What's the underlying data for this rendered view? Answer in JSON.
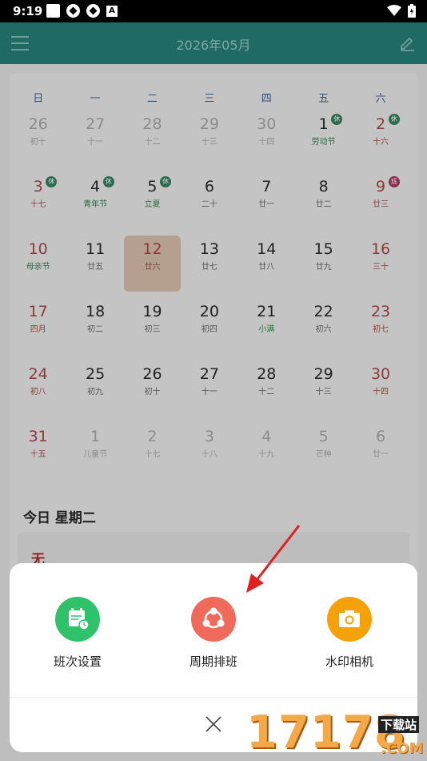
{
  "status_bar": {
    "time": "9:19",
    "a_label": "A"
  },
  "app_bar": {
    "title": "2026年05月"
  },
  "calendar": {
    "weekdays": [
      "日",
      "一",
      "二",
      "三",
      "四",
      "五",
      "六"
    ],
    "days": [
      {
        "d": "26",
        "l": "初十",
        "dim": true
      },
      {
        "d": "27",
        "l": "十一",
        "dim": true
      },
      {
        "d": "28",
        "l": "十二",
        "dim": true
      },
      {
        "d": "29",
        "l": "十三",
        "dim": true
      },
      {
        "d": "30",
        "l": "十四",
        "dim": true
      },
      {
        "d": "1",
        "l": "劳动节",
        "hol": true,
        "badge": "休"
      },
      {
        "d": "2",
        "l": "十六",
        "red": true,
        "badge": "休"
      },
      {
        "d": "3",
        "l": "十七",
        "red": true,
        "badge": "休"
      },
      {
        "d": "4",
        "l": "青年节",
        "hol": true,
        "badge": "休"
      },
      {
        "d": "5",
        "l": "立夏",
        "hol": true,
        "badge": "休"
      },
      {
        "d": "6",
        "l": "二十"
      },
      {
        "d": "7",
        "l": "廿一"
      },
      {
        "d": "8",
        "l": "廿二"
      },
      {
        "d": "9",
        "l": "廿三",
        "red": true,
        "badge": "班",
        "work": true
      },
      {
        "d": "10",
        "l": "母亲节",
        "red": true,
        "hol": true
      },
      {
        "d": "11",
        "l": "廿五"
      },
      {
        "d": "12",
        "l": "廿六",
        "today": true
      },
      {
        "d": "13",
        "l": "廿七"
      },
      {
        "d": "14",
        "l": "廿八"
      },
      {
        "d": "15",
        "l": "廿九"
      },
      {
        "d": "16",
        "l": "三十",
        "red": true
      },
      {
        "d": "17",
        "l": "四月",
        "red": true
      },
      {
        "d": "18",
        "l": "初二"
      },
      {
        "d": "19",
        "l": "初三"
      },
      {
        "d": "20",
        "l": "初四"
      },
      {
        "d": "21",
        "l": "小满",
        "hol": true
      },
      {
        "d": "22",
        "l": "初六"
      },
      {
        "d": "23",
        "l": "初七",
        "red": true
      },
      {
        "d": "24",
        "l": "初八",
        "red": true
      },
      {
        "d": "25",
        "l": "初九"
      },
      {
        "d": "26",
        "l": "初十"
      },
      {
        "d": "27",
        "l": "十一"
      },
      {
        "d": "28",
        "l": "十二"
      },
      {
        "d": "29",
        "l": "十三"
      },
      {
        "d": "30",
        "l": "十四",
        "red": true
      },
      {
        "d": "31",
        "l": "十五",
        "red": true
      },
      {
        "d": "1",
        "l": "儿童节",
        "dim": true
      },
      {
        "d": "2",
        "l": "十七",
        "dim": true
      },
      {
        "d": "3",
        "l": "十八",
        "dim": true
      },
      {
        "d": "4",
        "l": "十九",
        "dim": true
      },
      {
        "d": "5",
        "l": "芒种",
        "dim": true
      },
      {
        "d": "6",
        "l": "廿一",
        "dim": true
      }
    ]
  },
  "today_card": {
    "title": "今日 星期二",
    "content": "无"
  },
  "sheet": {
    "actions": [
      {
        "label": "班次设置",
        "color": "#2fc26b",
        "icon": "calendar-clock-icon"
      },
      {
        "label": "周期排班",
        "color": "#f06a5b",
        "icon": "share-cycle-icon"
      },
      {
        "label": "水印相机",
        "color": "#f5a20a",
        "icon": "camera-icon"
      }
    ]
  },
  "watermark": {
    "number": "17178",
    "tag": "下载站",
    "domain": ".COM"
  }
}
